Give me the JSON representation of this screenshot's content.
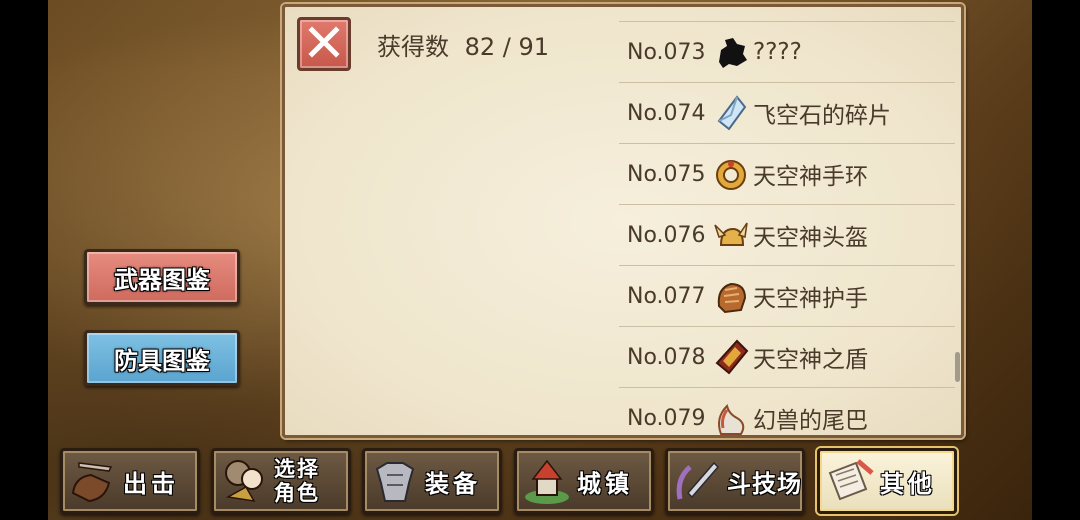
{
  "side_buttons": {
    "weapon_codex": "武器图鉴",
    "armor_codex": "防具图鉴"
  },
  "panel": {
    "close_icon": "close-icon",
    "count_label": "获得数",
    "count_value": "82 / 91",
    "items": [
      {
        "no": "No.073",
        "name": "????",
        "icon": "unknown-silhouette-icon"
      },
      {
        "no": "No.074",
        "name": "飞空石的碎片",
        "icon": "crystal-shard-icon"
      },
      {
        "no": "No.075",
        "name": "天空神手环",
        "icon": "bracelet-icon"
      },
      {
        "no": "No.076",
        "name": "天空神头盔",
        "icon": "winged-helmet-icon"
      },
      {
        "no": "No.077",
        "name": "天空神护手",
        "icon": "gauntlet-icon"
      },
      {
        "no": "No.078",
        "name": "天空神之盾",
        "icon": "shield-icon"
      },
      {
        "no": "No.079",
        "name": "幻兽的尾巴",
        "icon": "beast-tail-icon"
      }
    ]
  },
  "bottom_nav": [
    {
      "label": "出击",
      "icon": "sortie-icon",
      "active": false
    },
    {
      "label": "选择",
      "label2": "角色",
      "icon": "character-select-icon",
      "active": false
    },
    {
      "label": "装备",
      "icon": "armor-equip-icon",
      "active": false
    },
    {
      "label": "城镇",
      "icon": "town-icon",
      "active": false
    },
    {
      "label": "斗技场",
      "icon": "arena-sword-icon",
      "active": false
    },
    {
      "label": "其他",
      "icon": "other-scroll-icon",
      "active": true
    }
  ],
  "colors": {
    "weapon_button": "#d97064",
    "armor_button": "#6cb3da",
    "close_button": "#d4665a",
    "parchment": "#f3ead3",
    "text": "#4a3a2a"
  }
}
